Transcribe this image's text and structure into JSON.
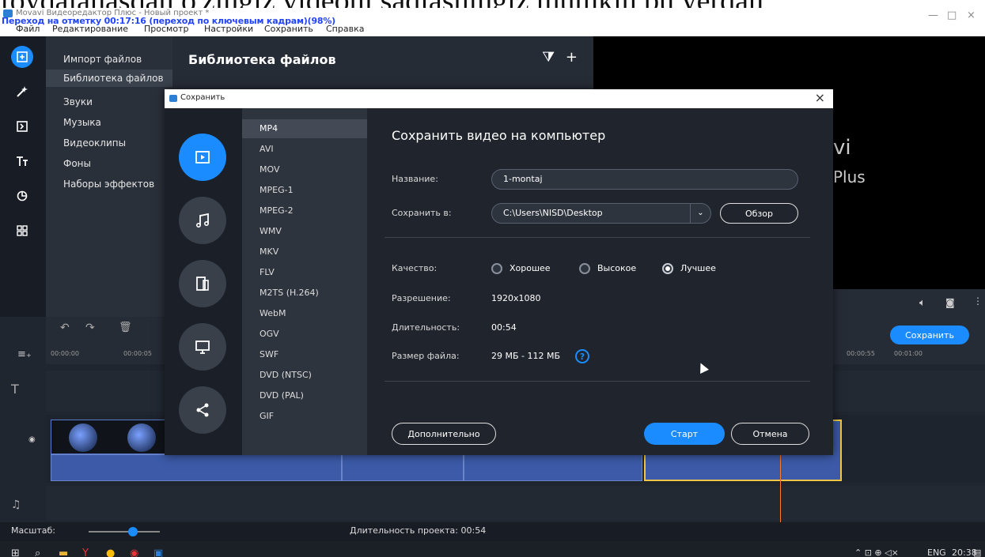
{
  "caption": "foydalanasdan o'zingiz videoni saqlashingiz mumkin bu yerdan",
  "window": {
    "title": "Movavi Видеоредактор Плюс - Новый проект *",
    "overlay": "Переход на отметку 00:17:16 (переход по ключевым кадрам)(98%)",
    "minimize": "—",
    "maximize": "□",
    "close": "×"
  },
  "menu": [
    "Файл",
    "Редактирование",
    "Просмотр",
    "Настройки",
    "Сохранить",
    "Справка"
  ],
  "sidebar": {
    "items": [
      "Импорт файлов",
      "Библиотека файлов",
      "Звуки",
      "Музыка",
      "Видеоклипы",
      "Фоны",
      "Наборы эффектов"
    ],
    "selected": "Библиотека файлов"
  },
  "library": {
    "title": "Библиотека файлов",
    "filter": "⧩",
    "add": "+"
  },
  "preview": {
    "brand_a": "vi",
    "brand_b": "Plus"
  },
  "timeline": {
    "timecodes": [
      "00:00:00",
      "00:00:05",
      "00:00:55",
      "00:01:00"
    ],
    "save_button": "Сохранить"
  },
  "status": {
    "scale_label": "Масштаб:",
    "duration": "Длительность проекта: 00:54"
  },
  "taskbar": {
    "lang": "ENG",
    "time": "20:38"
  },
  "dialog": {
    "title": "Сохранить",
    "close": "×",
    "heading": "Сохранить видео на компьютер",
    "formats": [
      "MP4",
      "AVI",
      "MOV",
      "MPEG-1",
      "MPEG-2",
      "WMV",
      "MKV",
      "FLV",
      "M2TS (H.264)",
      "WebM",
      "OGV",
      "SWF",
      "DVD (NTSC)",
      "DVD (PAL)",
      "GIF"
    ],
    "selected_format": "MP4",
    "fields": {
      "name_label": "Название:",
      "name_value": "1-montaj",
      "saveto_label": "Сохранить в:",
      "saveto_value": "C:\\Users\\NISD\\Desktop",
      "browse": "Обзор",
      "quality_label": "Качество:",
      "quality_options": [
        "Хорошее",
        "Высокое",
        "Лучшее"
      ],
      "quality_selected": "Лучшее",
      "resolution_label": "Разрешение:",
      "resolution_value": "1920x1080",
      "duration_label": "Длительность:",
      "duration_value": "00:54",
      "size_label": "Размер файла:",
      "size_value": "29 МБ - 112 МБ",
      "help": "?"
    },
    "buttons": {
      "advanced": "Дополнительно",
      "start": "Старт",
      "cancel": "Отмена"
    }
  }
}
